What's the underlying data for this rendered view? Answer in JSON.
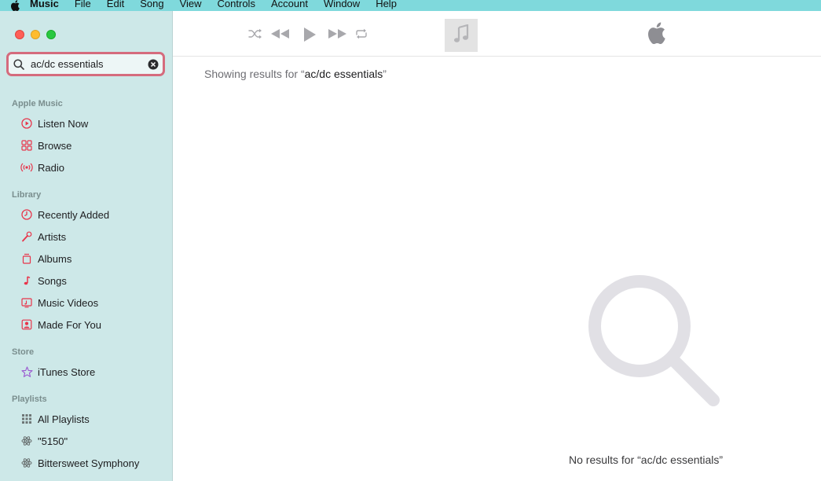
{
  "menubar": {
    "app_name": "Music",
    "items": [
      "File",
      "Edit",
      "Song",
      "View",
      "Controls",
      "Account",
      "Window",
      "Help"
    ]
  },
  "search": {
    "value": "ac/dc essentials"
  },
  "sidebar": {
    "apple_music_header": "Apple Music",
    "apple_music_items": [
      {
        "label": "Listen Now",
        "icon": "play-circle-icon"
      },
      {
        "label": "Browse",
        "icon": "grid-icon"
      },
      {
        "label": "Radio",
        "icon": "radio-waves-icon"
      }
    ],
    "library_header": "Library",
    "library_items": [
      {
        "label": "Recently Added",
        "icon": "clock-icon"
      },
      {
        "label": "Artists",
        "icon": "microphone-icon"
      },
      {
        "label": "Albums",
        "icon": "album-stack-icon"
      },
      {
        "label": "Songs",
        "icon": "music-note-icon"
      },
      {
        "label": "Music Videos",
        "icon": "video-icon"
      },
      {
        "label": "Made For You",
        "icon": "person-icon"
      }
    ],
    "store_header": "Store",
    "store_items": [
      {
        "label": "iTunes Store",
        "icon": "star-icon"
      }
    ],
    "playlists_header": "Playlists",
    "playlist_items": [
      {
        "label": "All Playlists",
        "icon": "grid-dots-icon"
      },
      {
        "label": "\"5150\"",
        "icon": "atom-icon"
      },
      {
        "label": "Bittersweet Symphony",
        "icon": "atom-icon"
      }
    ]
  },
  "main": {
    "showing_prefix": "Showing results for “",
    "showing_query": "ac/dc essentials",
    "showing_suffix": "”",
    "no_results": "No results for “ac/dc essentials”"
  },
  "colors": {
    "accent": "#e8344a",
    "sidebar_bg": "#cde8e8",
    "menubar_bg": "#7fd9dc"
  }
}
